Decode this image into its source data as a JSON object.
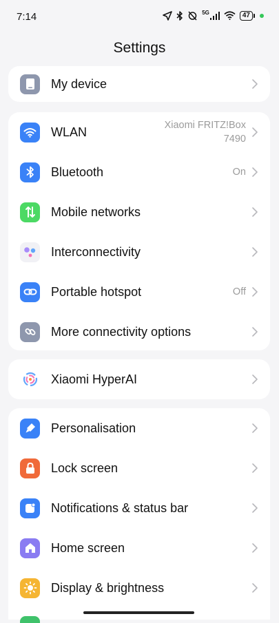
{
  "status_bar": {
    "time": "7:14",
    "network_type": "5G",
    "battery": "47"
  },
  "header": {
    "title": "Settings"
  },
  "groups": [
    {
      "items": [
        {
          "label": "My device",
          "value": "",
          "icon": "phone-icon",
          "color": "#8e97ad"
        }
      ]
    },
    {
      "items": [
        {
          "label": "WLAN",
          "value": "Xiaomi FRITZ!Box 7490",
          "icon": "wifi-icon",
          "color": "#3a82f7"
        },
        {
          "label": "Bluetooth",
          "value": "On",
          "icon": "bluetooth-icon",
          "color": "#3a82f7"
        },
        {
          "label": "Mobile networks",
          "value": "",
          "icon": "mobile-data-icon",
          "color": "#4cd964"
        },
        {
          "label": "Interconnectivity",
          "value": "",
          "icon": "interconnectivity-icon",
          "color": "#f1f1f5"
        },
        {
          "label": "Portable hotspot",
          "value": "Off",
          "icon": "hotspot-icon",
          "color": "#3a82f7"
        },
        {
          "label": "More connectivity options",
          "value": "",
          "icon": "connectivity-link-icon",
          "color": "#8e97ad"
        }
      ]
    },
    {
      "items": [
        {
          "label": "Xiaomi HyperAI",
          "value": "",
          "icon": "hyperai-icon",
          "color": "#ffffff"
        }
      ]
    },
    {
      "items": [
        {
          "label": "Personalisation",
          "value": "",
          "icon": "brush-icon",
          "color": "#3a82f7"
        },
        {
          "label": "Lock screen",
          "value": "",
          "icon": "lock-icon",
          "color": "#f06a3a"
        },
        {
          "label": "Notifications & status bar",
          "value": "",
          "icon": "notification-icon",
          "color": "#3a82f7"
        },
        {
          "label": "Home screen",
          "value": "",
          "icon": "home-icon",
          "color": "#8a7cf2"
        },
        {
          "label": "Display & brightness",
          "value": "",
          "icon": "sun-icon",
          "color": "#f5b533"
        }
      ]
    }
  ]
}
